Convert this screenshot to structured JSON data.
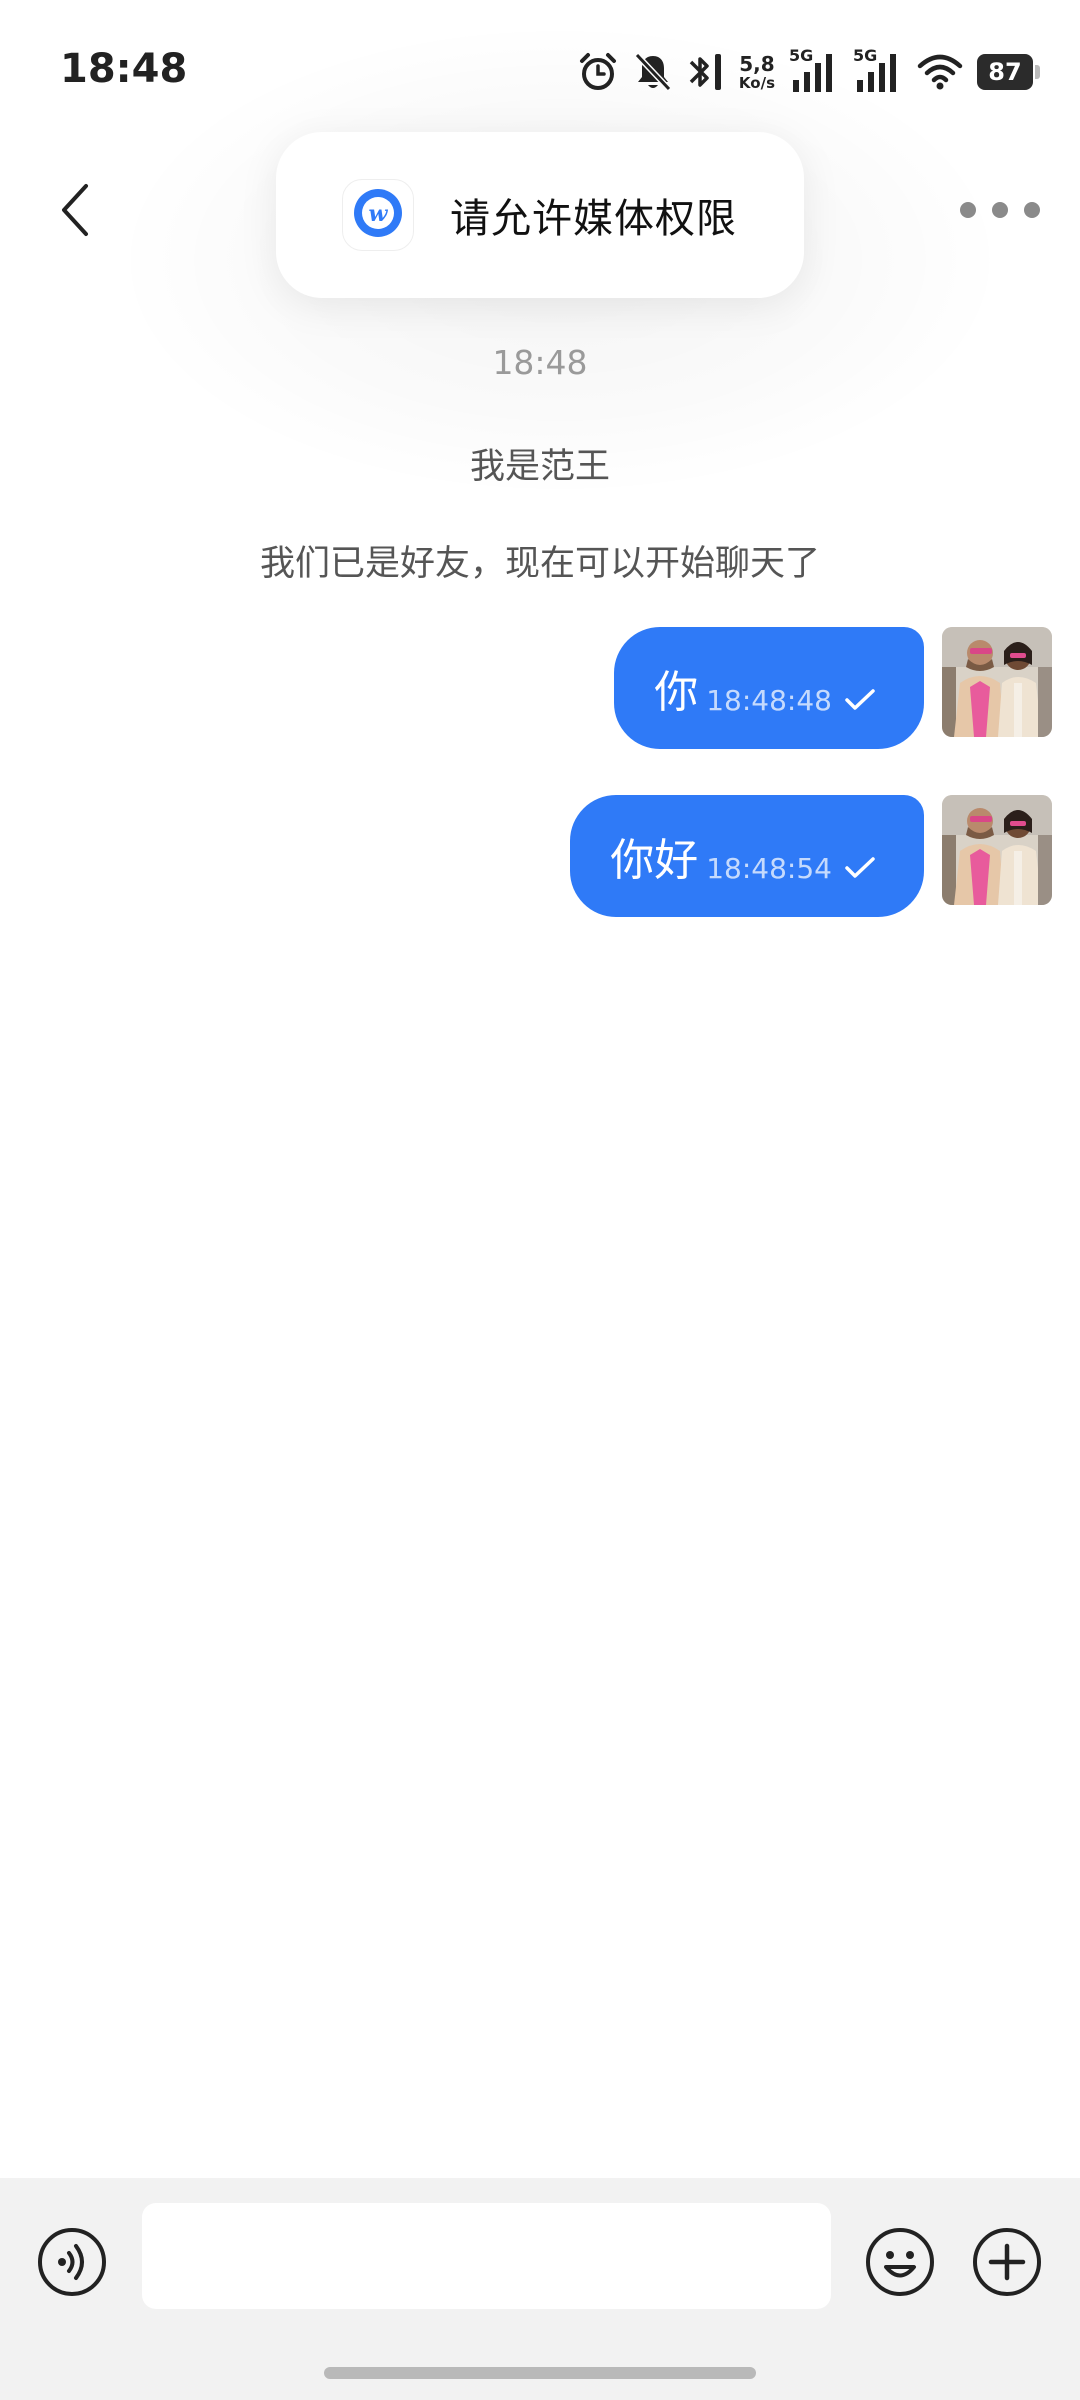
{
  "status_bar": {
    "time": "18:48",
    "net_speed_value": "5,8",
    "net_speed_unit": "Ko/s",
    "sim1_label": "5G",
    "sim2_label": "5G",
    "battery": "87",
    "icons": [
      "alarm-icon",
      "bell-off-icon",
      "bluetooth-icon",
      "signal-icon",
      "signal-icon",
      "wifi-icon",
      "battery-icon"
    ]
  },
  "header": {
    "back_icon": "chevron-left-icon",
    "more_icon": "more-dots-icon"
  },
  "toast": {
    "text": "请允许媒体权限",
    "logo_icon": "app-logo-icon"
  },
  "chat": {
    "system_time": "18:48",
    "system_notes": [
      "我是范王",
      "我们已是好友，现在可以开始聊天了"
    ],
    "messages": [
      {
        "text": "你",
        "time": "18:48:48",
        "status": "sent"
      },
      {
        "text": "你好",
        "time": "18:48:54",
        "status": "sent"
      }
    ]
  },
  "input_bar": {
    "placeholder": "",
    "voice_icon": "voice-icon",
    "emoji_icon": "emoji-icon",
    "plus_icon": "plus-icon"
  },
  "colors": {
    "bubble": "#2f7af7",
    "input_bar_bg": "#f2f2f2",
    "brand": "#2f7af7"
  }
}
